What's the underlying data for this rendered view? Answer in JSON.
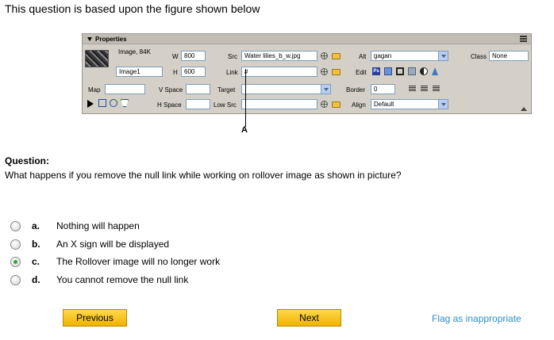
{
  "intro": "This question is based upon the figure shown below",
  "panel": {
    "title": "Properties",
    "image_info": "Image, 84K",
    "w_label": "W",
    "w_value": "800",
    "h_label": "H",
    "h_value": "600",
    "image_name": "Image1",
    "src_label": "Src",
    "src_value": "Water lilies_b_w.jpg",
    "link_label": "Link",
    "link_value": "#",
    "alt_label": "Alt",
    "alt_value": "gagan",
    "edit_label": "Edit",
    "ps_label": "Ps",
    "class_label": "Class",
    "class_value": "None",
    "map_label": "Map",
    "vspace_label": "V Space",
    "hspace_label": "H Space",
    "target_label": "Target",
    "lowsrc_label": "Low Src",
    "border_label": "Border",
    "border_value": "0",
    "align_label": "Align",
    "align_value": "Default"
  },
  "callout": "A",
  "question": {
    "heading": "Question:",
    "text": "What happens if you remove the null link while working on rollover image as shown in picture?",
    "options": [
      {
        "letter": "a.",
        "text": "Nothing will happen",
        "checked": false
      },
      {
        "letter": "b.",
        "text": "An X sign will be displayed",
        "checked": false
      },
      {
        "letter": "c.",
        "text": "The Rollover image will no longer work",
        "checked": true
      },
      {
        "letter": "d.",
        "text": "You cannot remove the null link",
        "checked": false
      }
    ]
  },
  "buttons": {
    "previous": "Previous",
    "next": "Next"
  },
  "flag": "Flag as inappropriate"
}
